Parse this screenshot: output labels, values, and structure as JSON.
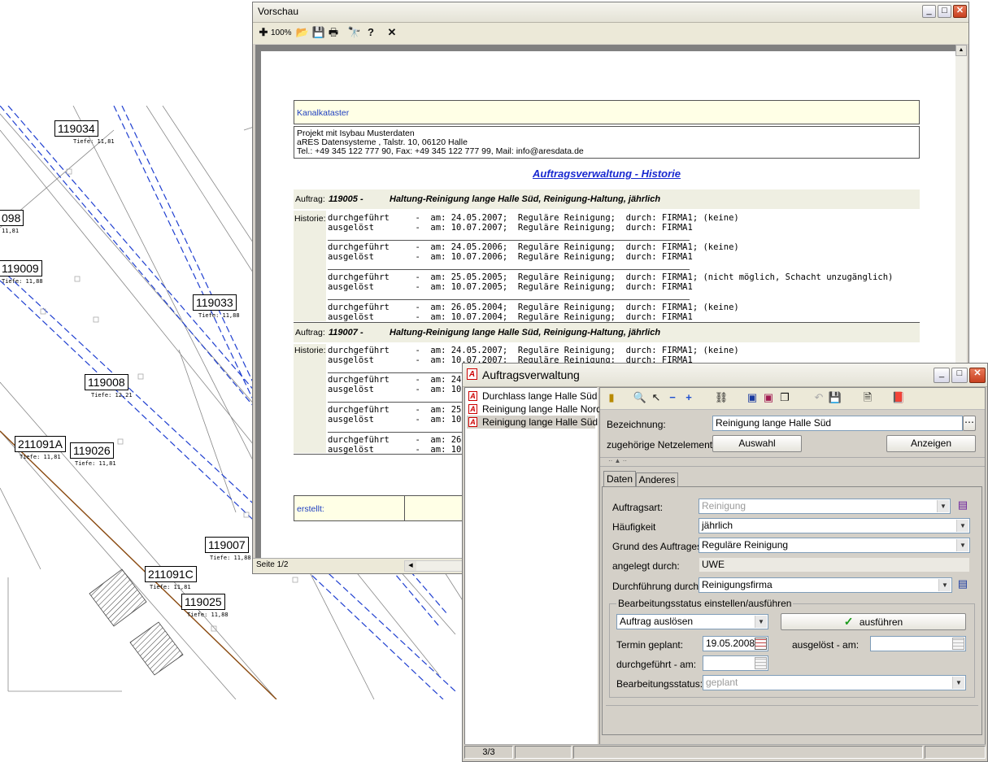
{
  "map": {
    "labels": [
      {
        "id": "119034",
        "sub": "Tiefe: 11,81"
      },
      {
        "id": "098",
        "sub": "11,81"
      },
      {
        "id": "119009",
        "sub": "Tiefe: 11,88"
      },
      {
        "id": "119033",
        "sub": "Tiefe: 11,88"
      },
      {
        "id": "119008",
        "sub": "Tiefe: 12,21"
      },
      {
        "id": "211091A",
        "sub": "Tiefe: 11,81"
      },
      {
        "id": "119026",
        "sub": "Tiefe: 11,81"
      },
      {
        "id": "119007",
        "sub": "Tiefe: 11,88"
      },
      {
        "id": "211091C",
        "sub": "Tiefe: 11,81"
      },
      {
        "id": "119025",
        "sub": "Tiefe: 11,88"
      }
    ]
  },
  "preview": {
    "title": "Vorschau",
    "zoom": "100%",
    "status_page": "Seite 1/2",
    "header_box_title": "Kanalkataster",
    "header_lines": [
      "Projekt mit Isybau Musterdaten",
      "aRES Datensysteme , Talstr. 10, 06120 Halle",
      "Tel.: +49 345 122 777 90, Fax: +49 345 122 777 99, Mail: info@aresdata.de"
    ],
    "report_title": "Auftragsverwaltung - Historie",
    "auftrag_label": "Auftrag:",
    "historie_label": "Historie:",
    "footer_label": "erstellt:",
    "orders": [
      {
        "number": "119005 -",
        "desc": "Haltung-Reinigung lange Halle Süd, Reinigung-Haltung, jährlich",
        "blocks": [
          [
            "durchgeführt     -  am: 24.05.2007;  Reguläre Reinigung;  durch: FIRMA1; (keine)",
            "ausgelöst        -  am: 10.07.2007;  Reguläre Reinigung;  durch: FIRMA1"
          ],
          [
            "durchgeführt     -  am: 24.05.2006;  Reguläre Reinigung;  durch: FIRMA1; (keine)",
            "ausgelöst        -  am: 10.07.2006;  Reguläre Reinigung;  durch: FIRMA1"
          ],
          [
            "durchgeführt     -  am: 25.05.2005;  Reguläre Reinigung;  durch: FIRMA1; (nicht möglich, Schacht unzugänglich)",
            "ausgelöst        -  am: 10.07.2005;  Reguläre Reinigung;  durch: FIRMA1"
          ],
          [
            "durchgeführt     -  am: 26.05.2004;  Reguläre Reinigung;  durch: FIRMA1; (keine)",
            "ausgelöst        -  am: 10.07.2004;  Reguläre Reinigung;  durch: FIRMA1"
          ]
        ]
      },
      {
        "number": "119007 -",
        "desc": "Haltung-Reinigung lange Halle Süd, Reinigung-Haltung, jährlich",
        "blocks": [
          [
            "durchgeführt     -  am: 24.05.2007;  Reguläre Reinigung;  durch: FIRMA1; (keine)",
            "ausgelöst        -  am: 10.07.2007;  Reguläre Reinigung;  durch: FIRMA1"
          ],
          [
            "durchgeführt     -  am: 24.",
            "ausgelöst        -  am: 10."
          ],
          [
            "durchgeführt     -  am: 25.",
            "ausgelöst        -  am: 10."
          ],
          [
            "durchgeführt     -  am: 26.",
            "ausgelöst        -  am: 10."
          ]
        ]
      }
    ]
  },
  "auftrag": {
    "title": "Auftragsverwaltung",
    "list": [
      "Durchlass lange Halle Süd",
      "Reinigung lange Halle Nord",
      "Reinigung lange Halle Süd"
    ],
    "selected_index": 2,
    "bezeichnung_label": "Bezeichnung:",
    "bezeichnung_value": "Reinigung lange Halle Süd",
    "netz_label": "zugehörige Netzelemente:",
    "auswahl_btn": "Auswahl",
    "anzeigen_btn": "Anzeigen",
    "tabs": [
      "Daten",
      "Anderes"
    ],
    "auftragsart_label": "Auftragsart:",
    "auftragsart_value": "Reinigung",
    "haeufigkeit_label": "Häufigkeit",
    "haeufigkeit_value": "jährlich",
    "grund_label": "Grund des Auftrages:",
    "grund_value": "Reguläre Reinigung",
    "angelegt_label": "angelegt durch:",
    "angelegt_value": "UWE",
    "durchfuehrung_label": "Durchführung durch:",
    "durchfuehrung_value": "Reinigungsfirma",
    "status_group_label": "Bearbeitungsstatus einstellen/ausführen",
    "action_value": "Auftrag auslösen",
    "ausfuehren_btn": "ausführen",
    "termin_label": "Termin geplant:",
    "termin_value": "19.05.2008",
    "ausgeloest_label": "ausgelöst - am:",
    "ausgeloest_value": "",
    "durchgefuehrt_label": "durchgeführt - am:",
    "durchgefuehrt_value": "",
    "bstatus_label": "Bearbeitungsstatus:",
    "bstatus_value": "geplant",
    "status_count": "3/3"
  }
}
